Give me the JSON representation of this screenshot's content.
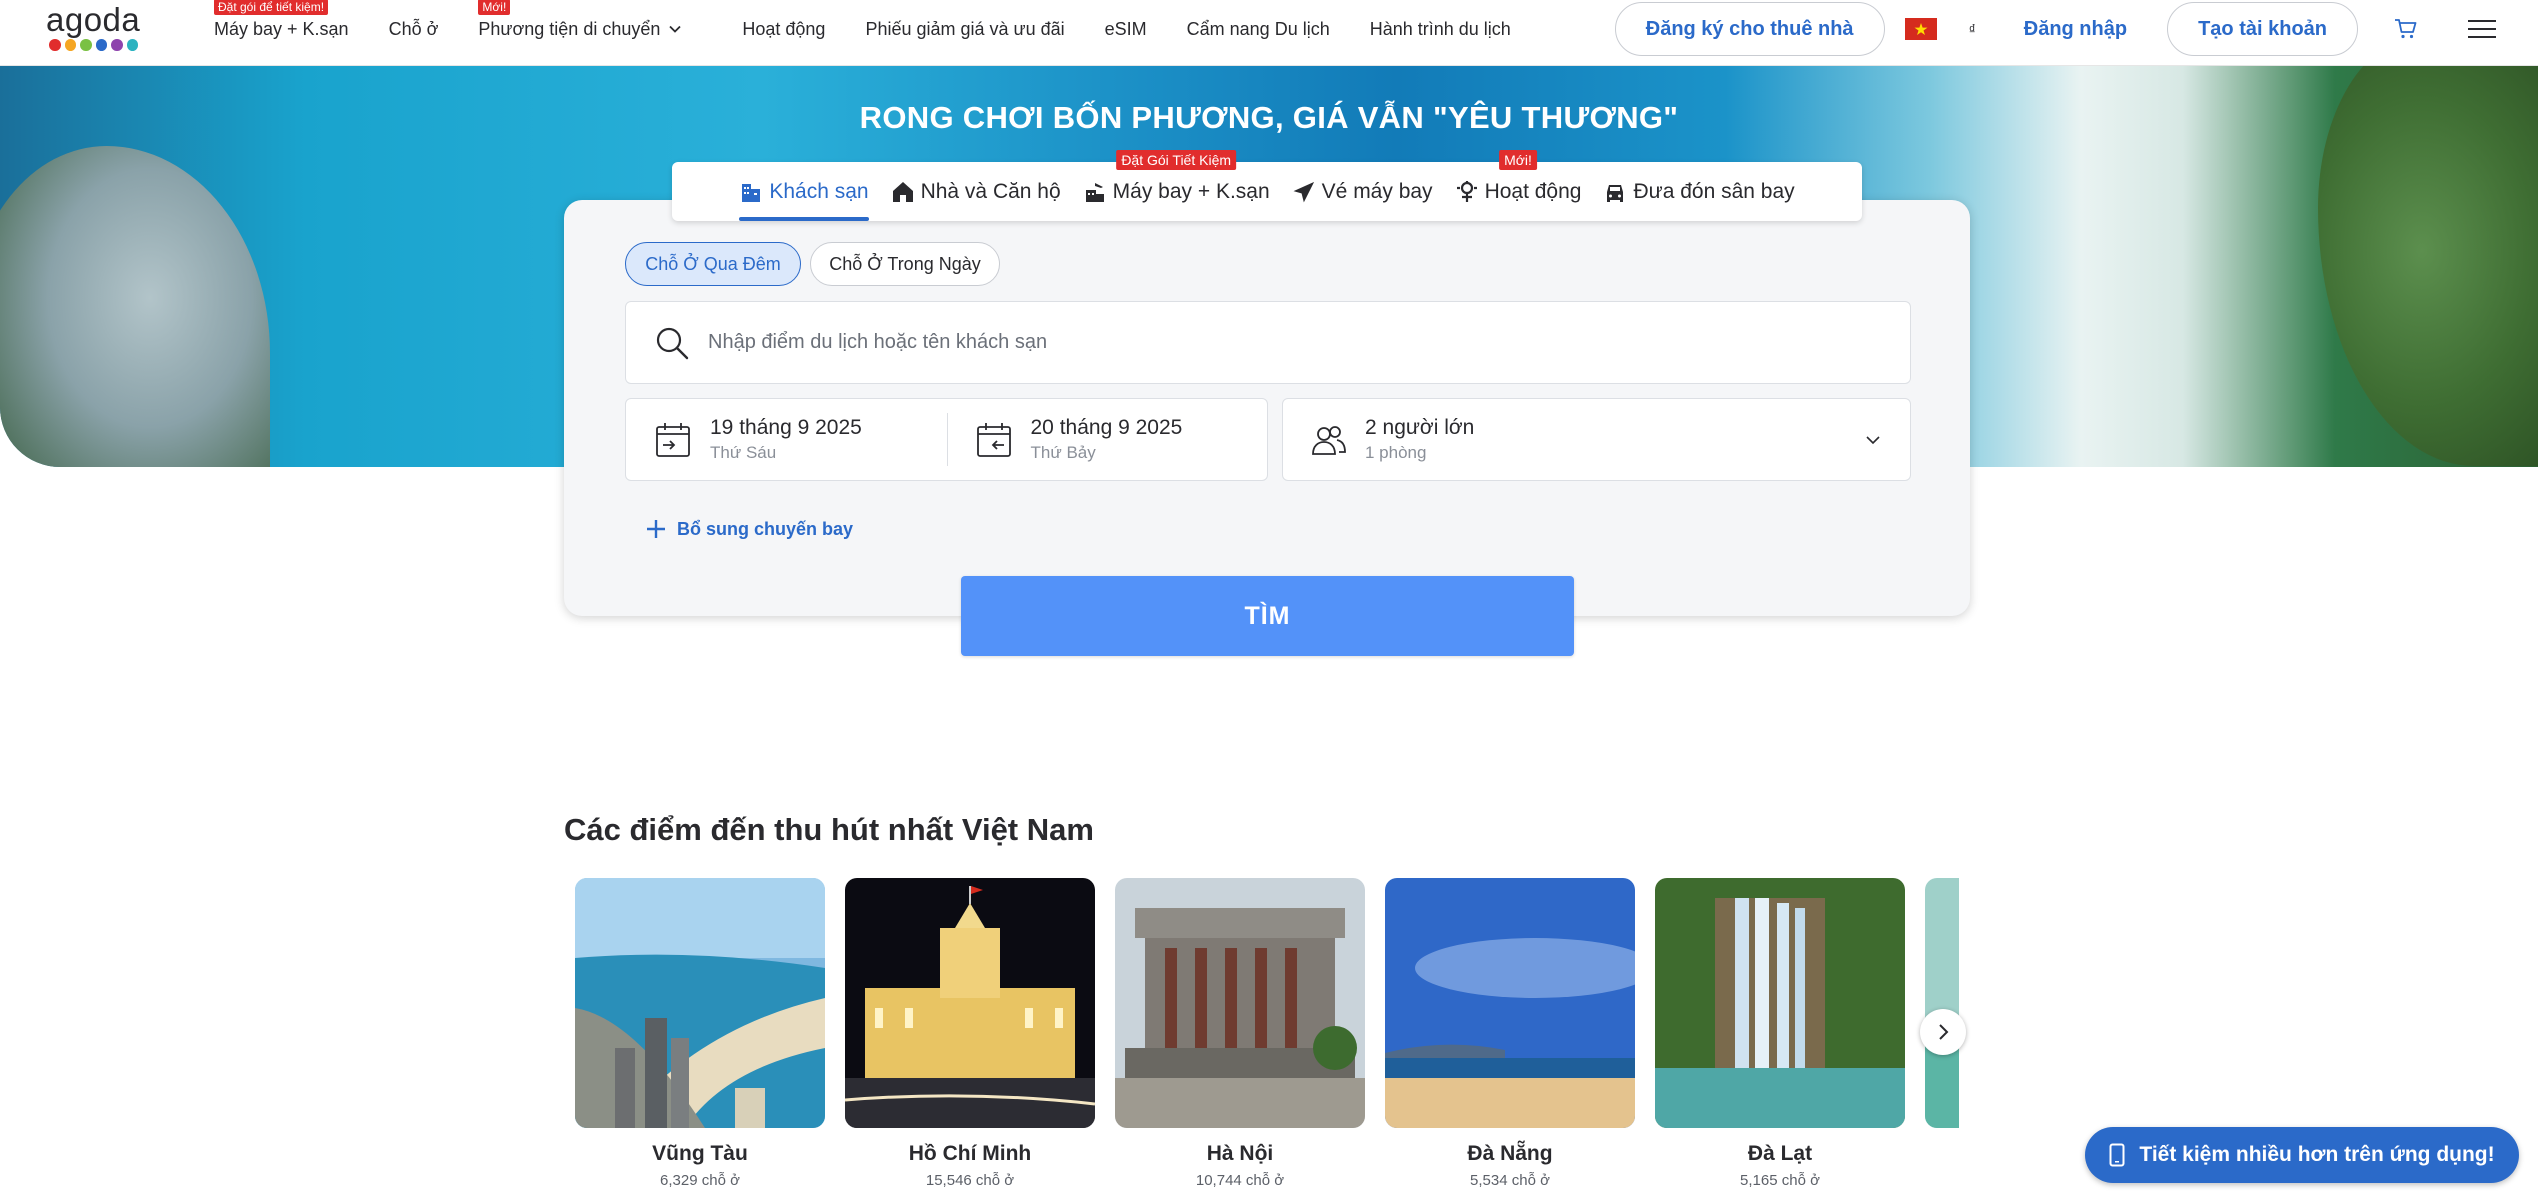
{
  "header": {
    "logo_text": "agoda",
    "logo_dot_colors": [
      "#e12d2d",
      "#f5a623",
      "#7ac143",
      "#2b6ac9",
      "#8e44ad",
      "#2bb3c0"
    ],
    "nav": [
      {
        "label": "Máy bay + K.sạn",
        "badge": "Đặt gói để tiết kiệm!"
      },
      {
        "label": "Chỗ ở",
        "badge": ""
      },
      {
        "label": "Phương tiện di chuyển",
        "badge": "Mới!"
      },
      {
        "label": "Hoạt động",
        "badge": ""
      },
      {
        "label": "Phiếu giảm giá và ưu đãi",
        "badge": ""
      },
      {
        "label": "eSIM",
        "badge": ""
      },
      {
        "label": "Cẩm nang Du lịch",
        "badge": ""
      },
      {
        "label": "Hành trình du lịch",
        "badge": ""
      }
    ],
    "list_property_label": "Đăng ký cho thuê nhà",
    "currency": "₫",
    "login_label": "Đăng nhập",
    "signup_label": "Tạo tài khoản"
  },
  "hero": {
    "title": "RONG CHƠI BỐN PHƯƠNG, GIÁ VẪN \"YÊU THƯƠNG\""
  },
  "product_tabs": [
    {
      "label": "Khách sạn",
      "icon": "hotel-icon",
      "badge": "",
      "active": true
    },
    {
      "label": "Nhà và Căn hộ",
      "icon": "home-icon",
      "badge": "",
      "active": false
    },
    {
      "label": "Máy bay + K.sạn",
      "icon": "flight-hotel-icon",
      "badge": "Đặt Gói Tiết Kiệm",
      "active": false
    },
    {
      "label": "Vé máy bay",
      "icon": "plane-icon",
      "badge": "",
      "active": false
    },
    {
      "label": "Hoạt động",
      "icon": "activity-icon",
      "badge": "Mới!",
      "active": false
    },
    {
      "label": "Đưa đón sân bay",
      "icon": "car-icon",
      "badge": "",
      "active": false
    }
  ],
  "search": {
    "stay_overnight_label": "Chỗ Ở Qua Đêm",
    "day_use_label": "Chỗ Ở Trong Ngày",
    "destination_placeholder": "Nhập điểm du lịch hoặc tên khách sạn",
    "check_in_date": "19 tháng 9 2025",
    "check_in_day": "Thứ Sáu",
    "check_out_date": "20 tháng 9 2025",
    "check_out_day": "Thứ Bảy",
    "guests": "2 người lớn",
    "rooms": "1 phòng",
    "add_flight_label": "Bổ sung chuyến bay",
    "search_button": "TÌM"
  },
  "destinations": {
    "title": "Các điểm đến thu hút nhất Việt Nam",
    "items": [
      {
        "name": "Vũng Tàu",
        "count": "6,329 chỗ ở"
      },
      {
        "name": "Hồ Chí Minh",
        "count": "15,546 chỗ ở"
      },
      {
        "name": "Hà Nội",
        "count": "10,744 chỗ ở"
      },
      {
        "name": "Đà Nẵng",
        "count": "5,534 chỗ ở"
      },
      {
        "name": "Đà Lạt",
        "count": "5,165 chỗ ở"
      }
    ]
  },
  "app_banner": "Tiết kiệm nhiều hơn trên ứng dụng!",
  "colors": {
    "brand_blue": "#2b6ac9",
    "search_button": "#5392f9",
    "badge_red": "#e12d2d"
  }
}
